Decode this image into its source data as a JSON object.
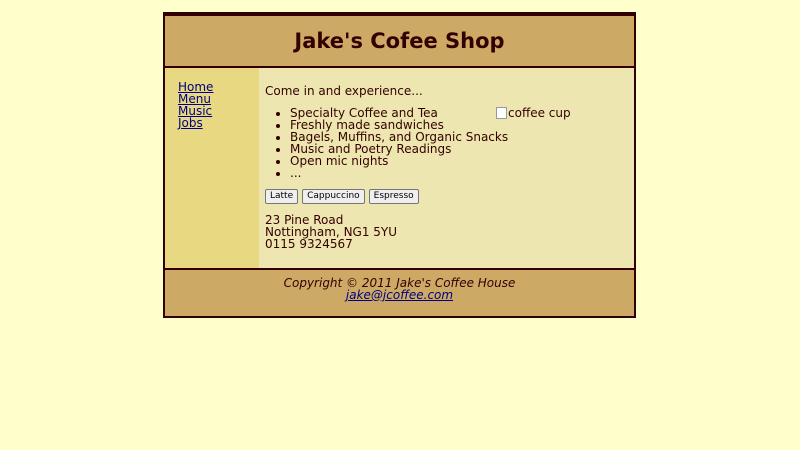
{
  "header": {
    "title": "Jake's Cofee Shop"
  },
  "nav": {
    "items": [
      {
        "label": "Home"
      },
      {
        "label": "Menu"
      },
      {
        "label": "Music"
      },
      {
        "label": "Jobs"
      }
    ]
  },
  "main": {
    "intro": "Come in and experience...",
    "features": [
      "Specialty Coffee and Tea",
      "Freshly made sandwiches",
      "Bagels, Muffins, and Organic Snacks",
      "Music and Poetry Readings",
      "Open mic nights",
      "..."
    ],
    "image_alt": "coffee cup",
    "buttons": [
      "Latte",
      "Cappuccino",
      "Espresso"
    ],
    "address": {
      "street": "23 Pine Road",
      "city": "Nottingham, NG1 5YU",
      "phone": "0115 9324567"
    }
  },
  "footer": {
    "copyright": "Copyright © 2011 Jake's Coffee House",
    "email": "jake@jcoffee.com"
  },
  "colors": {
    "page_bg": "#FFFFCC",
    "header_bg": "#CCAA66",
    "nav_bg": "#E8D882",
    "content_bg": "#EEE6B0",
    "text": "#330000",
    "link": "#000080"
  }
}
